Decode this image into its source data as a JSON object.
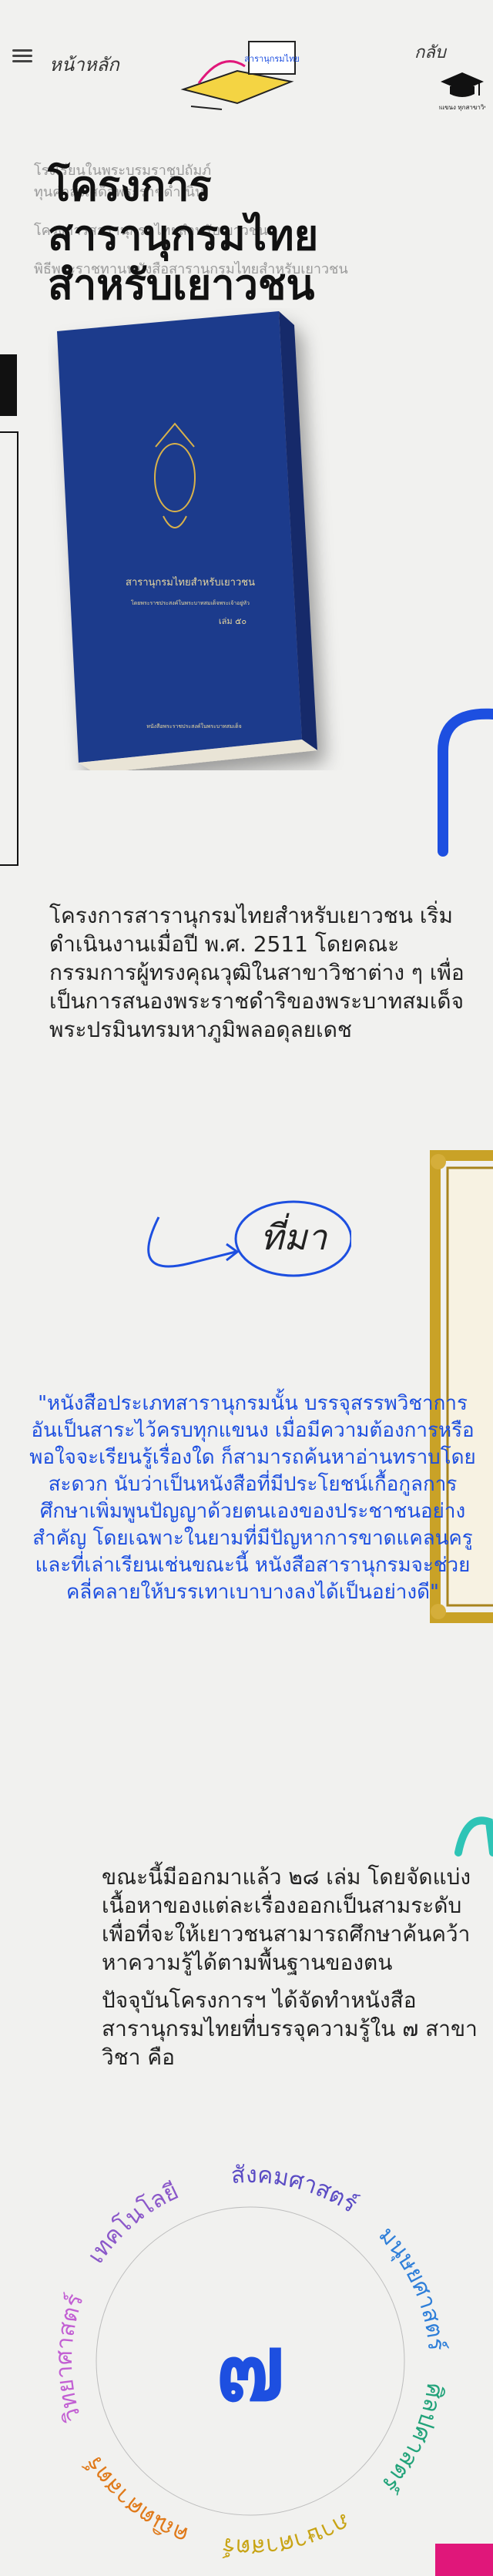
{
  "nav": {
    "menu_icon": "hamburger-icon",
    "home_label": "หน้าหลัก",
    "back_label": "กลับ",
    "brand_label": "ทุกแขนง ทุกสาขาวิชา",
    "header_art_label": "สารานุกรมไทย"
  },
  "hero": {
    "ghost_lines": [
      "โรงเรียนในพระบรมราชูปถัมภ์",
      "ทุนคำสั่งเสด็จพระราชดำเนิน",
      "โครงการสารานุกรมไทยสำหรับเยาวชน",
      "พิธีพระราชทานหนังสือสารานุกรมไทยสำหรับเยาวชน"
    ],
    "title_lines": [
      "โครงการ",
      "สารานุกรมไทย",
      "สำหรับเยาวชน"
    ]
  },
  "book": {
    "title": "สารานุกรมไทยสำหรับเยาวชน",
    "subtitle": "โดยพระราชประสงค์ในพระบาทสมเด็จพระเจ้าอยู่หัว",
    "volume": "เล่ม ๕๐",
    "footer": "หนังสือพระราชประสงค์ในพระบาทสมเด็จ"
  },
  "intro": {
    "text": "โครงการสารานุกรมไทยสำหรับเยาวชน เริ่มดำเนินงานเมื่อปี พ.ศ. 2511 โดยคณะกรรมการผู้ทรงคุณวุฒิในสาขาวิชาต่าง ๆ เพื่อเป็นการสนองพระราชดำริของพระบาทสมเด็จพระปรมินทรมหาภูมิพลอดุลยเดช"
  },
  "handwriting": {
    "text": "ที่มา"
  },
  "quote": {
    "text": "\"หนังสือประเภทสารานุกรมนั้น บรรจุสรรพวิชาการอันเป็นสาระไว้ครบทุกแขนง เมื่อมีความต้องการหรือพอใจจะเรียนรู้เรื่องใด ก็สามารถค้นหาอ่านทราบโดยสะดวก นับว่าเป็นหนังสือที่มีประโยชน์เกื้อกูลการศึกษาเพิ่มพูนปัญญาด้วยตนเองของประชาชนอย่างสำคัญ โดยเฉพาะในยามที่มีปัญหาการขาดแคลนครูและที่เล่าเรียนเช่นขณะนี้ หนังสือสารานุกรมจะช่วยคลี่คลายให้บรรเทาเบาบางลงได้เป็นอย่างดี\""
  },
  "details": {
    "p1": "ขณะนี้มีออกมาแล้ว ๒๘ เล่ม โดยจัดแบ่งเนื้อหาของแต่ละเรื่องออกเป็นสามระดับเพื่อที่จะให้เยาวชนสามารถศึกษาค้นคว้าหาความรู้ได้ตามพื้นฐานของตน",
    "p2": "ปัจจุบันโครงการฯ ได้จัดทำหนังสือสารานุกรมไทยที่บรรจุความรู้ใน ๗ สาขาวิชา คือ"
  },
  "subjects": {
    "center": "๗",
    "items": [
      {
        "label": "วิทยาศาสตร์",
        "color": "#c25fd3"
      },
      {
        "label": "เทคโนโลยี",
        "color": "#8b58c9"
      },
      {
        "label": "สังคมศาสตร์",
        "color": "#5a4bc4"
      },
      {
        "label": "มนุษยศาสตร์",
        "color": "#2f7fd9"
      },
      {
        "label": "ศิลปศาสตร์",
        "color": "#22a37a"
      },
      {
        "label": "ภาษาศาสตร์",
        "color": "#c8a415"
      },
      {
        "label": "คณิตศาสตร์",
        "color": "#e07a1a"
      }
    ]
  },
  "colors": {
    "accent_blue": "#1d4fe0",
    "gold": "#c9a227",
    "teal": "#2ec4b6",
    "pink": "#e0177a"
  }
}
